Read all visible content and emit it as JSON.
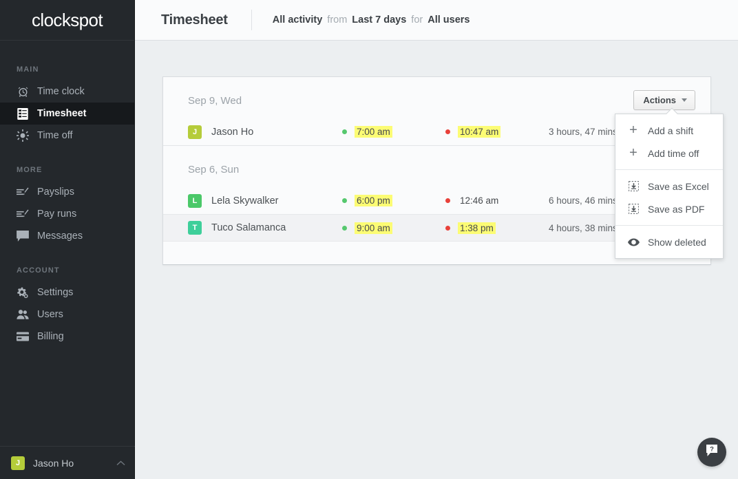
{
  "brand": {
    "name": "clockspot"
  },
  "sidebar": {
    "sections": [
      {
        "label": "MAIN",
        "items": [
          {
            "label": "Time clock",
            "icon": "clock-icon",
            "active": false
          },
          {
            "label": "Timesheet",
            "icon": "timesheet-icon",
            "active": true
          },
          {
            "label": "Time off",
            "icon": "sun-icon",
            "active": false
          }
        ]
      },
      {
        "label": "MORE",
        "items": [
          {
            "label": "Payslips",
            "icon": "payslip-icon",
            "active": false
          },
          {
            "label": "Pay runs",
            "icon": "payrun-icon",
            "active": false
          },
          {
            "label": "Messages",
            "icon": "message-icon",
            "active": false
          }
        ]
      },
      {
        "label": "ACCOUNT",
        "items": [
          {
            "label": "Settings",
            "icon": "gear-icon",
            "active": false
          },
          {
            "label": "Users",
            "icon": "users-icon",
            "active": false
          },
          {
            "label": "Billing",
            "icon": "card-icon",
            "active": false
          }
        ]
      }
    ],
    "footer": {
      "name": "Jason Ho",
      "initial": "J",
      "avatar_color": "#b5cc3a",
      "caret": "⌃"
    }
  },
  "header": {
    "title": "Timesheet",
    "filters": {
      "activity": "All activity",
      "from_label": "from",
      "range": "Last 7 days",
      "for_label": "for",
      "users": "All users"
    }
  },
  "timesheet": {
    "groups": [
      {
        "date_label": "Sep 9, Wed",
        "actions_label": "Actions",
        "rows": [
          {
            "initial": "J",
            "avatar_color": "#b5cc3a",
            "name": "Jason Ho",
            "clock_in": "7:00 am",
            "clock_in_highlight": true,
            "clock_out": "10:47 am",
            "clock_out_highlight": true,
            "duration": "3 hours, 47 mins",
            "hovered": false
          }
        ]
      },
      {
        "date_label": "Sep 6, Sun",
        "rows": [
          {
            "initial": "L",
            "avatar_color": "#4bc869",
            "name": "Lela Skywalker",
            "clock_in": "6:00 pm",
            "clock_in_highlight": true,
            "clock_out": "12:46 am",
            "clock_out_highlight": false,
            "duration": "6 hours, 46 mins",
            "hovered": false
          },
          {
            "initial": "T",
            "avatar_color": "#3ecf9a",
            "name": "Tuco Salamanca",
            "clock_in": "9:00 am",
            "clock_in_highlight": true,
            "clock_out": "1:38 pm",
            "clock_out_highlight": true,
            "duration": "4 hours, 38 mins",
            "hovered": true
          }
        ]
      }
    ]
  },
  "dropdown": {
    "groups": [
      {
        "items": [
          {
            "label": "Add a shift",
            "icon": "plus-icon"
          },
          {
            "label": "Add time off",
            "icon": "plus-icon"
          }
        ]
      },
      {
        "items": [
          {
            "label": "Save as Excel",
            "icon": "download-icon"
          },
          {
            "label": "Save as PDF",
            "icon": "download-icon"
          }
        ]
      },
      {
        "items": [
          {
            "label": "Show deleted",
            "icon": "eye-icon"
          }
        ]
      }
    ]
  },
  "help": {
    "icon": "help-chat-icon"
  },
  "colors": {
    "sidebar_bg": "#24282c",
    "sidebar_active_bg": "#16191c",
    "accent_green": "#56c86e",
    "accent_red": "#e8413a",
    "highlight_yellow": "#fcfc74",
    "annotation_red": "#ee1c1c"
  }
}
